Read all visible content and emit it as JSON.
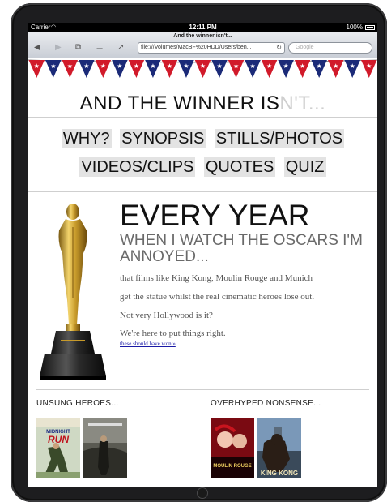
{
  "status_bar": {
    "carrier": "Carrier",
    "wifi_icon": "wifi-icon",
    "time": "12:11 PM",
    "battery": "100%"
  },
  "browser": {
    "page_title": "And the winner isn't...",
    "url": "file:///Volumes/MacBF%20HDD/Users/ben...",
    "search_placeholder": "Google",
    "icons": [
      "back-icon",
      "forward-icon",
      "tabs-icon",
      "bookmarks-icon",
      "share-icon",
      "reload-icon"
    ]
  },
  "site": {
    "title_main": "AND THE WINNER IS",
    "title_faded": "N'T...",
    "nav_row1": [
      "WHY?",
      "SYNOPSIS",
      "STILLS/PHOTOS"
    ],
    "nav_row2": [
      "VIDEOS/CLIPS",
      "QUOTES",
      "QUIZ"
    ]
  },
  "hero": {
    "heading": "EVERY YEAR",
    "subheading": "WHEN I WATCH THE OSCARS I'M ANNOYED...",
    "lines": [
      "that films like King Kong, Moulin Rouge and Munich",
      "get the statue whilst the real cinematic heroes lose out.",
      "Not very Hollywood is it?",
      "We're here to put things right."
    ],
    "link": "these should have won »"
  },
  "sections": {
    "unsung": "UNSUNG HEROES...",
    "overhyped": "OVERHYPED NONSENSE...",
    "posters": {
      "moulin_rouge": "MOULIN ROUGE",
      "king_kong": "KING KONG"
    }
  },
  "colors": {
    "bunting_red": "#d11a2a",
    "bunting_blue": "#1b2a78",
    "nav_bg": "#e3e3e3"
  }
}
